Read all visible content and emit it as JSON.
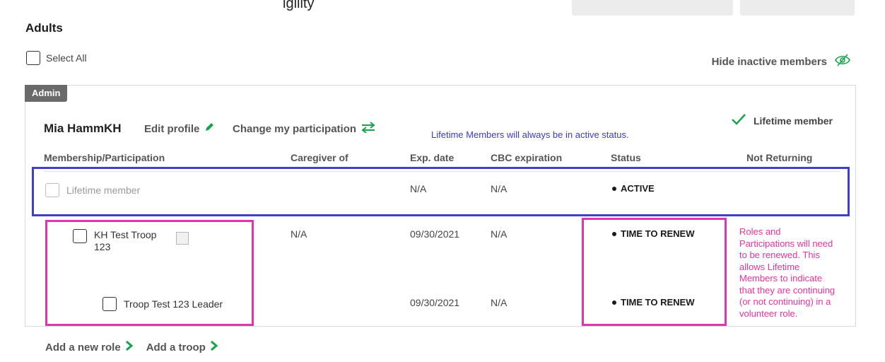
{
  "page": {
    "top_caption": "igility",
    "section_title": "Adults",
    "select_all_label": "Select All",
    "hide_inactive_label": "Hide inactive members"
  },
  "member": {
    "tag": "Admin",
    "name": "Mia HammKH",
    "edit_profile": "Edit profile",
    "change_participation": "Change my participation",
    "lifetime_badge": "Lifetime member",
    "blue_note": "Lifetime Members will always be in active status."
  },
  "table": {
    "headers": [
      "Membership/Participation",
      "Caregiver of",
      "Exp. date",
      "CBC expiration",
      "Status",
      "Not Returning"
    ],
    "rows": [
      {
        "membership": "Lifetime member",
        "caregiver": "",
        "exp_date": "N/A",
        "cbc": "N/A",
        "status": "ACTIVE"
      },
      {
        "membership": "KH Test Troop 123",
        "caregiver": "N/A",
        "exp_date": "09/30/2021",
        "cbc": "N/A",
        "status": "TIME TO RENEW"
      },
      {
        "membership": "Troop Test 123 Leader",
        "caregiver": "",
        "exp_date": "09/30/2021",
        "cbc": "N/A",
        "status": "TIME TO RENEW"
      }
    ]
  },
  "pink_note": "Roles and Participations will need to be renewed. This allows Lifetime Members to indicate that they are continuing (or not continuing) in a volunteer role.",
  "links": {
    "add_role": "Add a new role",
    "add_troop": "Add a troop"
  },
  "colors": {
    "accent_green": "#17a34a",
    "annotation_blue": "#3f3fc7",
    "annotation_pink": "#e035b0",
    "tag_gray": "#6a6a6a"
  },
  "icons": [
    "pencil-icon",
    "swap-arrows-icon",
    "checkmark-icon",
    "eye-slash-icon",
    "chevron-right-icon"
  ]
}
